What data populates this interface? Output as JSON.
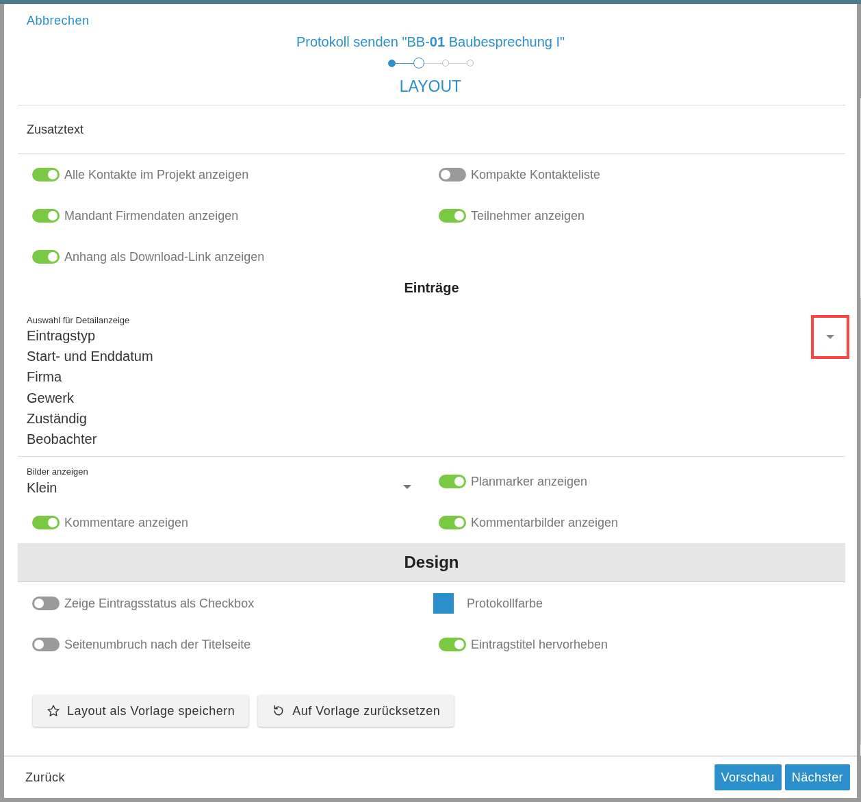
{
  "header": {
    "cancel": "Abbrechen",
    "title": "Protokoll senden \"BB-**01** Baubesprechung I\"",
    "steps": [
      {
        "completed": true,
        "selected": false
      },
      {
        "completed": false,
        "selected": true
      },
      {
        "completed": false,
        "selected": false
      },
      {
        "completed": false,
        "selected": false
      }
    ],
    "section": "LAYOUT"
  },
  "extra_text": {
    "label": "Zusatztext"
  },
  "options": [
    [
      {
        "kind": "toggle",
        "label": "Alle Kontakte im Projekt anzeigen",
        "on": true
      },
      {
        "kind": "toggle",
        "label": "Kompakte Kontakteliste",
        "on": false
      }
    ],
    [
      {
        "kind": "toggle",
        "label": "Mandant Firmendaten anzeigen",
        "on": true
      },
      {
        "kind": "toggle",
        "label": "Teilnehmer anzeigen",
        "on": true
      }
    ],
    [
      {
        "kind": "toggle",
        "label": "Anhang als Download-Link anzeigen",
        "on": true
      }
    ]
  ],
  "entries": {
    "heading": "Einträge",
    "detail_select": {
      "label": "Auswahl für Detailanzeige",
      "highlighted": true,
      "values": [
        "Eintragstyp",
        "Start- und Enddatum",
        "Firma",
        "Gewerk",
        "Zuständig",
        "Beobachter"
      ]
    },
    "rows": [
      [
        {
          "kind": "select",
          "label": "Bilder anzeigen",
          "value": "Klein"
        },
        {
          "kind": "toggle",
          "label": "Planmarker anzeigen",
          "on": true
        }
      ],
      [
        {
          "kind": "toggle",
          "label": "Kommentare anzeigen",
          "on": true
        },
        {
          "kind": "toggle",
          "label": "Kommentarbilder anzeigen",
          "on": true
        }
      ]
    ]
  },
  "design": {
    "heading": "Design",
    "rows": [
      [
        {
          "kind": "toggle",
          "label": "Zeige Eintragsstatus als Checkbox",
          "on": false
        },
        {
          "kind": "color",
          "label": "Protokollfarbe",
          "color": "#2a8fcb"
        }
      ],
      [
        {
          "kind": "toggle",
          "label": "Seitenumbruch nach der Titelseite",
          "on": false
        },
        {
          "kind": "toggle",
          "label": "Eintragstitel hervorheben",
          "on": true
        }
      ]
    ]
  },
  "actions": [
    {
      "kind": "star",
      "label": "Layout als Vorlage speichern"
    },
    {
      "kind": "reset",
      "label": "Auf Vorlage zurücksetzen"
    }
  ],
  "footer": {
    "back": "Zurück",
    "buttons": [
      "Vorschau",
      "Nächster"
    ]
  }
}
